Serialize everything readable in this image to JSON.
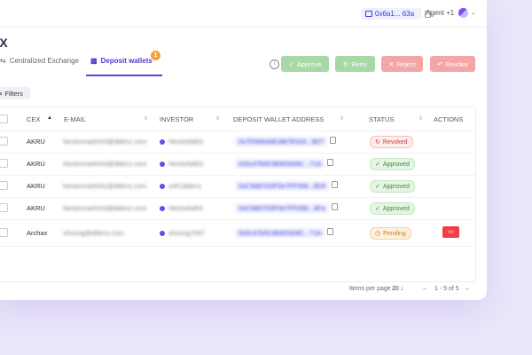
{
  "topbar": {
    "address": "0x6a1... 63a",
    "agent": "Agent +1"
  },
  "page": {
    "title": "EX"
  },
  "tabs": [
    {
      "label": "Centralized Exchange",
      "icon": "exchange-icon"
    },
    {
      "label": "Deposit wallets",
      "icon": "wallet-icon",
      "badge": "1"
    }
  ],
  "actions": {
    "approve": "Approve",
    "retry": "Retry",
    "reject": "Reject",
    "revoke": "Revoke"
  },
  "filters": {
    "label": "Filters"
  },
  "table": {
    "columns": [
      "CEX",
      "E-MAIL",
      "INVESTOR",
      "DEPOSIT WALLET ADDRESS",
      "STATUS",
      "ACTIONS"
    ],
    "rows": [
      {
        "cex": "AKRU",
        "email": "hectormartin03@ddenz.com",
        "investor": "Hectorbd03",
        "address": "0x7f29d0A8C8B7E033...9D7",
        "status": "Revoked"
      },
      {
        "cex": "AKRU",
        "email": "hectormartin03@ddenz.com",
        "investor": "Hectorbd03",
        "address": "0x5c47b5C8b9D0e8C...71A",
        "status": "Approved"
      },
      {
        "cex": "AKRU",
        "email": "hectormartin01@ddenz.com",
        "investor": "sofr1ddenz",
        "address": "0xC9d97D0F0e7FF058...9D6",
        "status": "Approved"
      },
      {
        "cex": "AKRU",
        "email": "hectormartin03@ddenz.com",
        "investor": "Hectorbd03",
        "address": "0xC9d97D0F0e7FF058...4Fa",
        "status": "Approved"
      },
      {
        "cex": "Archax",
        "email": "shuong@ddenz.com",
        "investor": "shuong7057",
        "address": "0x5c47b5C8b9D0e8C...71A",
        "status": "Pending"
      }
    ]
  },
  "footer": {
    "items_label": "Items per page",
    "items_value": "20",
    "range": "1 - 5 of 5"
  },
  "colors": {
    "accent": "#6a3de0",
    "approve": "#a7d8a6",
    "reject": "#f4a5a5",
    "danger": "#ef3f46"
  }
}
